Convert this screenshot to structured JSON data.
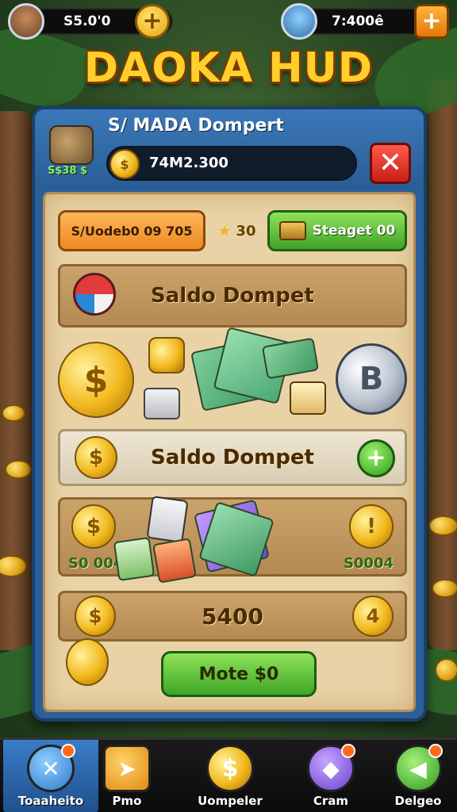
{
  "topbar": {
    "left_currency": "S5.0'0",
    "right_currency": "7:400ê"
  },
  "title": "DAOKA HUD",
  "panel": {
    "header_title": "S/ MADA Dompert",
    "header_icon_label": "S$38 $",
    "balance": "74M2.300",
    "close_symbol": "✕"
  },
  "actions": {
    "orange_label": "S/Uodeb0 09 705",
    "star_count": "30",
    "green_label": "Steaget 00"
  },
  "rows": {
    "saldo_1": "Saldo Dompet",
    "saldo_2": "Saldo Dompet",
    "add_symbol": "+"
  },
  "values": {
    "left": "S0 004",
    "right": "S0004",
    "total": "5400"
  },
  "bottom_button": "Mote $0",
  "nav": [
    {
      "label": "Toaaheito"
    },
    {
      "label": "Pmo"
    },
    {
      "label": "Uompeler"
    },
    {
      "label": "Cram"
    },
    {
      "label": "Delgeo"
    }
  ],
  "colors": {
    "title": "#ffcf2e",
    "panel": "#2b5f99",
    "parchment": "#e9d3a6",
    "green_button": "#3fa22a",
    "orange_button": "#ec8a22",
    "close_button": "#c91f16"
  },
  "icons": {
    "topbar_add": "plus-icon",
    "close": "close-icon",
    "coin": "coin-icon",
    "nav": [
      "crossed-swords-icon",
      "blade-icon",
      "coin-icon",
      "gem-icon",
      "shield-icon"
    ]
  }
}
